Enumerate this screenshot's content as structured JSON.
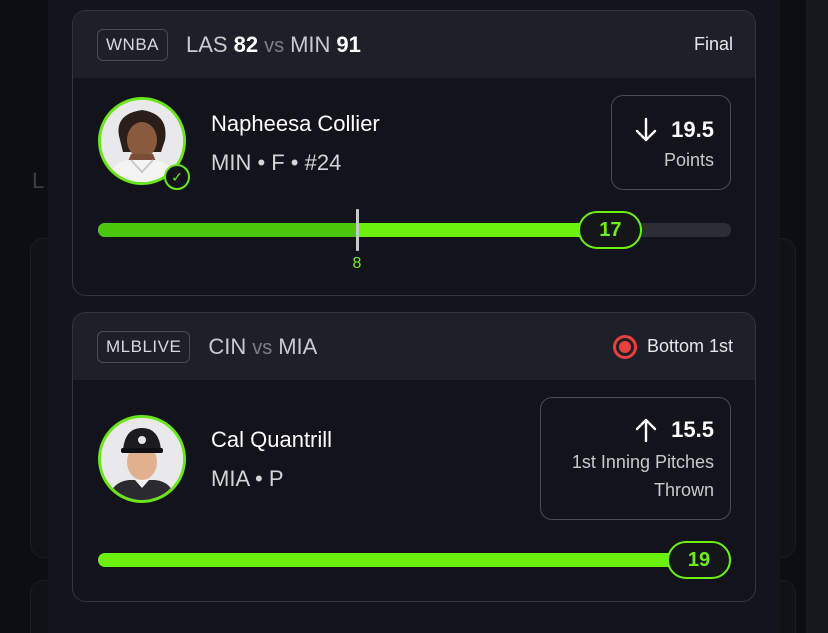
{
  "colors": {
    "accent_green": "#6cf10f",
    "live_red": "#e8413d",
    "card_bg": "#13141b",
    "header_bg": "#1e2029"
  },
  "background": {
    "ghost_letter": "L"
  },
  "cards": [
    {
      "league": "WNBA",
      "away_team": "LAS",
      "away_score": "82",
      "vs": "vs",
      "home_team": "MIN",
      "home_score": "91",
      "status": "Final",
      "player": {
        "name": "Napheesa Collier",
        "meta": "MIN • F • #24",
        "avatar_icon": "player-headshot",
        "verified_icon": "checkmark-icon"
      },
      "line": {
        "direction": "down",
        "direction_icon": "arrow-down-icon",
        "value": "19.5",
        "stat": "Points"
      },
      "progress": {
        "current": "17",
        "fraction": 0.86,
        "marker_value": "8",
        "marker_fraction": 0.41
      }
    },
    {
      "league": "MLBLIVE",
      "away_team": "CIN",
      "vs": "vs",
      "home_team": "MIA",
      "status": "Bottom 1st",
      "status_icon": "live-indicator-icon",
      "player": {
        "name": "Cal Quantrill",
        "meta": "MIA • P",
        "avatar_icon": "player-headshot"
      },
      "line": {
        "direction": "up",
        "direction_icon": "arrow-up-icon",
        "value": "15.5",
        "stat_line1": "1st Inning Pitches",
        "stat_line2": "Thrown"
      },
      "progress": {
        "current": "19",
        "fraction": 1.0
      }
    }
  ]
}
